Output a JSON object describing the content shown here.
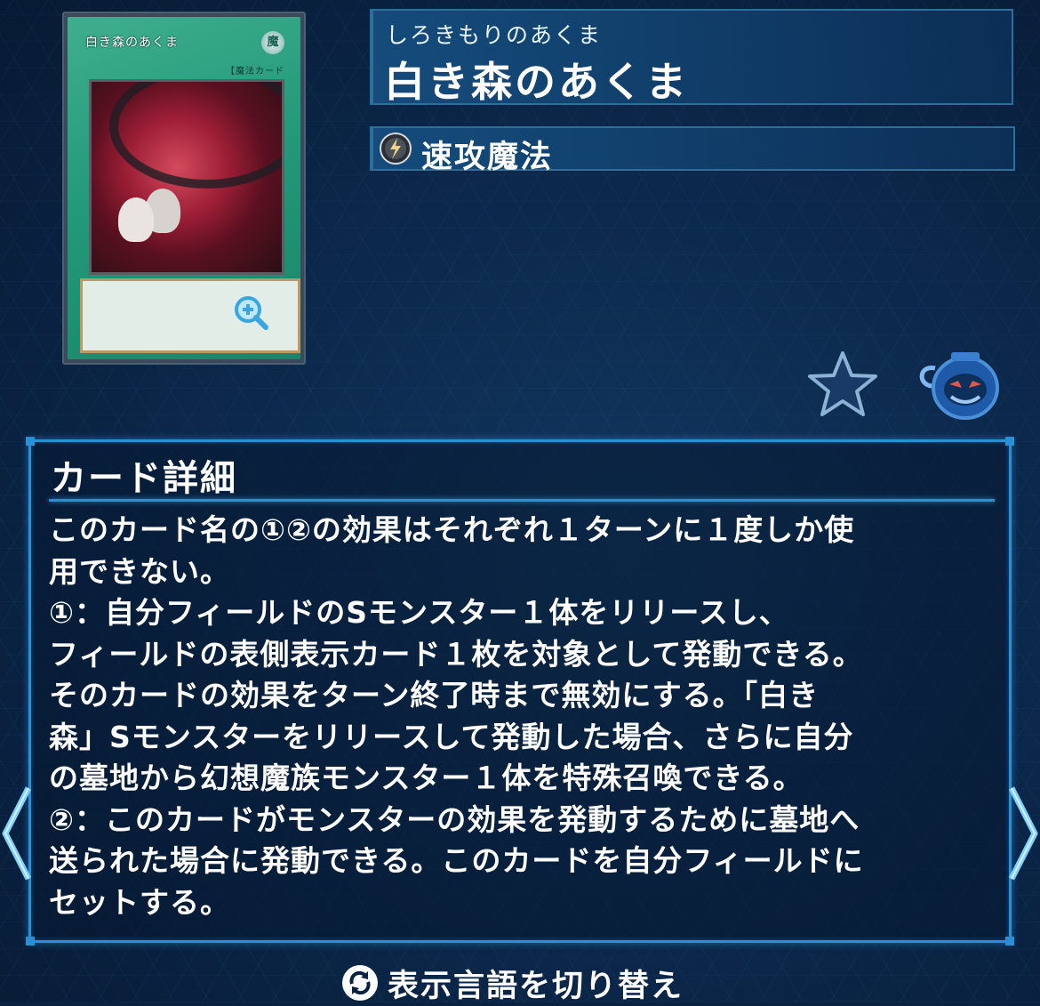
{
  "card": {
    "ruby": "しろきもりのあくま",
    "name": "白き森のあくま",
    "image": {
      "name": "白き森のあくま",
      "attribute": "魔",
      "type_line": "【魔法カード",
      "zoom_icon": "zoom-in-icon"
    },
    "spell_type_icon": "quick-play-spell-icon",
    "spell_type": "速攻魔法"
  },
  "actions": {
    "favorite_icon": "star-icon",
    "pot_icon": "pot-of-greed-icon"
  },
  "detail": {
    "title": "カード詳細",
    "lines": [
      "このカード名の①②の効果はそれぞれ１ターンに１度しか使",
      "用できない。",
      "①：自分フィールドのSモンスター１体をリリースし、",
      "フィールドの表側表示カード１枚を対象として発動できる。",
      "そのカードの効果をターン終了時まで無効にする。「白き",
      "森」Sモンスターをリリースして発動した場合、さらに自分",
      "の墓地から幻想魔族モンスター１体を特殊召喚できる。",
      "②：このカードがモンスターの効果を発動するために墓地へ",
      "送られた場合に発動できる。このカードを自分フィールドに",
      "セットする。"
    ]
  },
  "nav": {
    "prev_icon": "chevron-left-icon",
    "next_icon": "chevron-right-icon"
  },
  "language_toggle": {
    "icon": "refresh-icon",
    "label": "表示言語を切り替え"
  },
  "colors": {
    "background": "#0a2140",
    "accent": "#2a90d6",
    "card_green": "#239a7a"
  }
}
